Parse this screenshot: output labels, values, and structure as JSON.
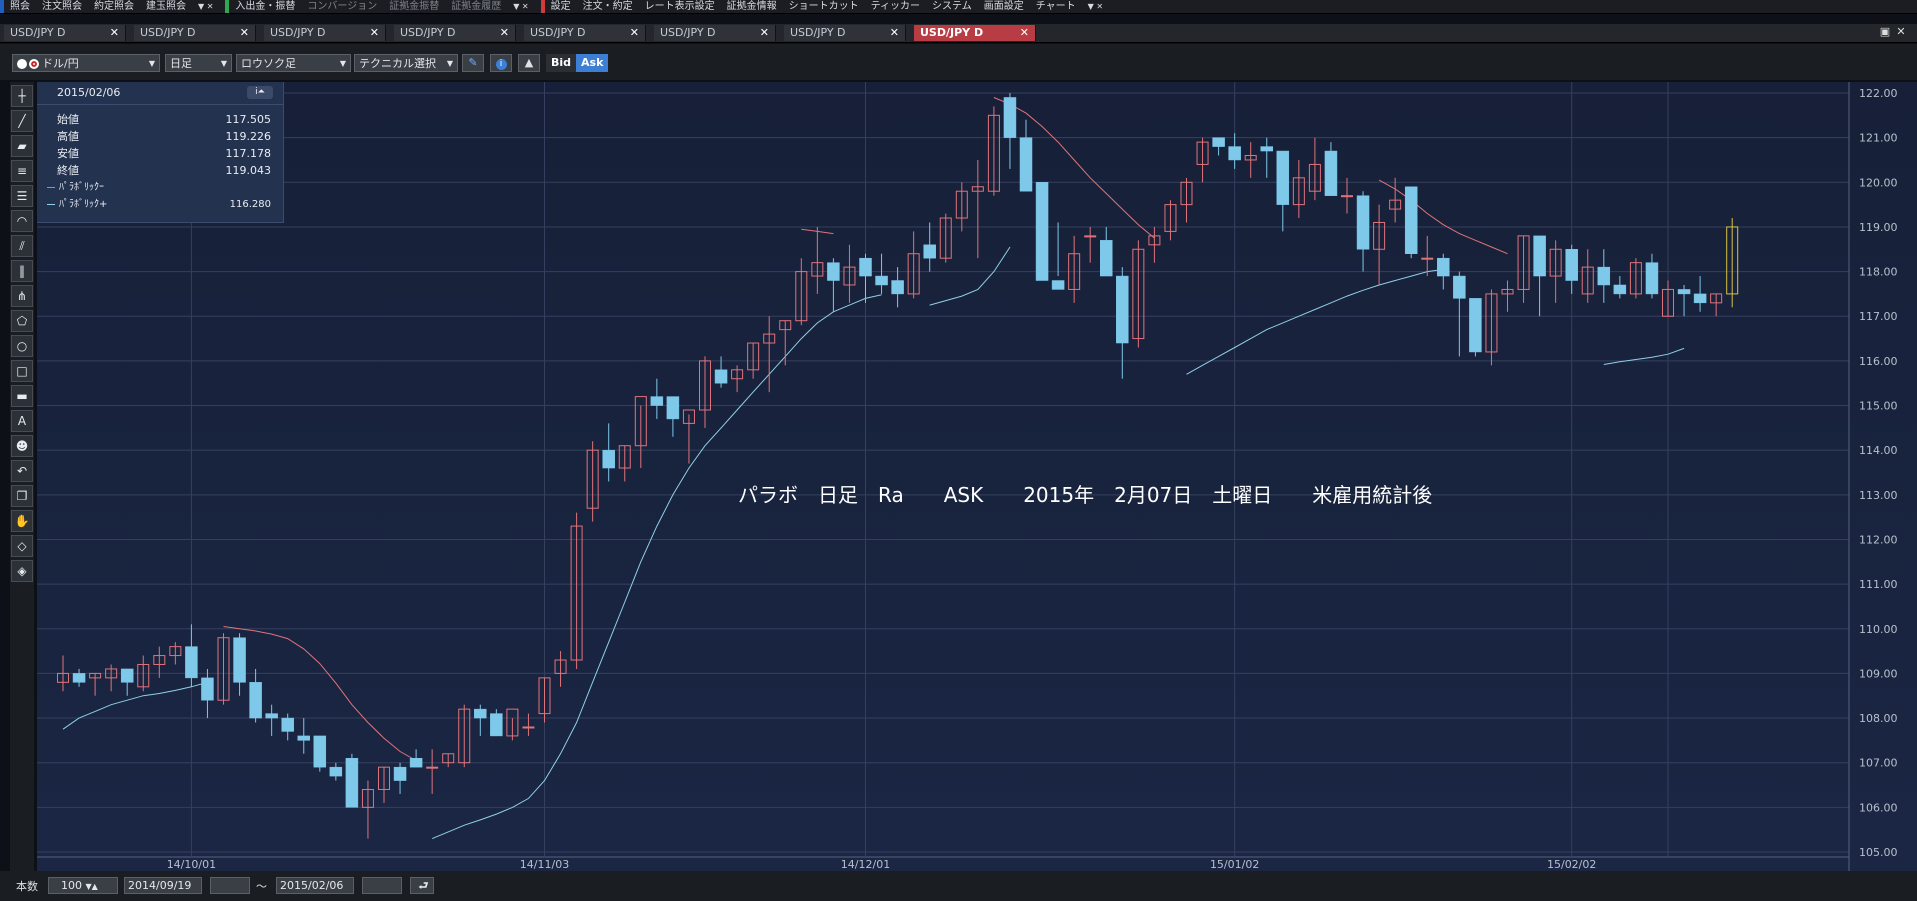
{
  "menubar": {
    "groups": [
      {
        "items": [
          "照会",
          "注文照会",
          "約定照会",
          "建玉照会"
        ]
      },
      {
        "items": [
          "入出金・振替",
          "コンバージョン",
          "証拠金振替",
          "証拠金履歴"
        ]
      },
      {
        "items": [
          "設定",
          "注文・約定",
          "レート表示設定",
          "証拠金情報",
          "ショートカット",
          "ティッカー",
          "システム",
          "画面設定",
          "チャート"
        ]
      }
    ]
  },
  "tabs": [
    "USD/JPY D",
    "USD/JPY D",
    "USD/JPY D",
    "USD/JPY D",
    "USD/JPY D",
    "USD/JPY D",
    "USD/JPY D",
    "USD/JPY D"
  ],
  "active_tab_index": 7,
  "toolbar": {
    "currency": "ドル/円",
    "period": "日足",
    "chart_type": "ロウソク足",
    "technical": "テクニカル選択",
    "bid_label": "Bid",
    "ask_label": "Ask"
  },
  "info_panel": {
    "date": "2015/02/06",
    "rows": [
      {
        "label": "始値",
        "value": "117.505"
      },
      {
        "label": "高値",
        "value": "119.226"
      },
      {
        "label": "安値",
        "value": "117.178"
      },
      {
        "label": "終値",
        "value": "119.043"
      }
    ],
    "indicators": [
      {
        "label": "ﾊﾟﾗﾎﾞﾘｯｸｰ",
        "value": "",
        "color": "#e0737a"
      },
      {
        "label": "ﾊﾟﾗﾎﾞﾘｯｸ+",
        "value": "116.280",
        "color": "#8fd1e8"
      }
    ]
  },
  "bottom": {
    "count_label": "本数",
    "count_value": "100",
    "from_date": "2014/09/19",
    "tilde": "～",
    "to_date": "2015/02/06"
  },
  "chart_data": {
    "type": "candlestick",
    "annotation": "パラボ　日足　Ra　　ASK　　2015年　2月07日　土曜日　　米雇用統計後",
    "ylim": [
      105,
      122
    ],
    "yticks": [
      "105.00",
      "106.00",
      "107.00",
      "108.00",
      "109.00",
      "110.00",
      "111.00",
      "112.00",
      "113.00",
      "114.00",
      "115.00",
      "116.00",
      "117.00",
      "118.00",
      "119.00",
      "120.00",
      "121.00",
      "122.00"
    ],
    "xticks": [
      {
        "label": "14/10/01",
        "index": 8
      },
      {
        "label": "14/11/03",
        "index": 30
      },
      {
        "label": "14/12/01",
        "index": 50
      },
      {
        "label": "15/01/02",
        "index": 73
      },
      {
        "label": "15/02/02",
        "index": 94
      },
      {
        "label": "",
        "index": 100
      }
    ],
    "colors": {
      "up": "#e0737a",
      "down": "#7ec8ea",
      "last": "#d8c24a",
      "sar_minus": "#e0737a",
      "sar_plus": "#8fd1e8"
    },
    "candles": [
      [
        108.8,
        109.4,
        108.6,
        109.0
      ],
      [
        109.0,
        109.1,
        108.7,
        108.8
      ],
      [
        108.9,
        109.0,
        108.5,
        109.0
      ],
      [
        108.9,
        109.2,
        108.6,
        109.1
      ],
      [
        109.1,
        109.1,
        108.5,
        108.8
      ],
      [
        108.7,
        109.4,
        108.6,
        109.2
      ],
      [
        109.2,
        109.6,
        108.9,
        109.4
      ],
      [
        109.4,
        109.7,
        109.2,
        109.6
      ],
      [
        109.6,
        110.1,
        108.7,
        108.9
      ],
      [
        108.9,
        109.1,
        108.0,
        108.4
      ],
      [
        108.4,
        109.9,
        108.3,
        109.8
      ],
      [
        109.8,
        109.9,
        108.5,
        108.8
      ],
      [
        108.8,
        109.1,
        107.9,
        108.0
      ],
      [
        108.1,
        108.3,
        107.6,
        108.0
      ],
      [
        108.0,
        108.1,
        107.5,
        107.7
      ],
      [
        107.6,
        108.0,
        107.2,
        107.5
      ],
      [
        107.6,
        107.6,
        106.8,
        106.9
      ],
      [
        106.9,
        107.0,
        106.6,
        106.7
      ],
      [
        107.1,
        107.2,
        106.2,
        106.0
      ],
      [
        106.0,
        106.6,
        105.3,
        106.4
      ],
      [
        106.4,
        106.9,
        106.1,
        106.9
      ],
      [
        106.9,
        107.0,
        106.3,
        106.6
      ],
      [
        107.1,
        107.3,
        107.0,
        106.9
      ],
      [
        106.9,
        107.3,
        106.3,
        106.9
      ],
      [
        107.0,
        107.2,
        106.9,
        107.2
      ],
      [
        107.0,
        108.3,
        106.9,
        108.2
      ],
      [
        108.2,
        108.3,
        107.6,
        108.0
      ],
      [
        108.1,
        108.2,
        107.6,
        107.6
      ],
      [
        107.6,
        108.0,
        107.5,
        108.2
      ],
      [
        107.8,
        108.1,
        107.6,
        107.8
      ],
      [
        108.1,
        108.9,
        107.9,
        108.9
      ],
      [
        109.0,
        109.5,
        108.7,
        109.3
      ],
      [
        109.3,
        112.6,
        109.1,
        112.3
      ],
      [
        112.7,
        114.2,
        112.4,
        114.0
      ],
      [
        114.0,
        114.6,
        113.3,
        113.6
      ],
      [
        113.6,
        114.1,
        113.3,
        114.1
      ],
      [
        114.1,
        115.0,
        113.6,
        115.2
      ],
      [
        115.2,
        115.6,
        114.7,
        115.0
      ],
      [
        115.2,
        115.2,
        114.3,
        114.7
      ],
      [
        114.6,
        114.8,
        113.7,
        114.9
      ],
      [
        114.9,
        116.1,
        114.5,
        116.0
      ],
      [
        115.8,
        116.1,
        115.4,
        115.5
      ],
      [
        115.6,
        115.9,
        115.3,
        115.8
      ],
      [
        115.8,
        116.4,
        115.6,
        116.4
      ],
      [
        116.4,
        117.0,
        115.3,
        116.6
      ],
      [
        116.7,
        116.9,
        115.9,
        116.9
      ],
      [
        116.9,
        118.3,
        116.8,
        118.0
      ],
      [
        117.9,
        119.0,
        117.5,
        118.2
      ],
      [
        118.2,
        118.3,
        117.1,
        117.8
      ],
      [
        117.7,
        118.6,
        117.3,
        118.1
      ],
      [
        118.3,
        118.4,
        117.3,
        117.9
      ],
      [
        117.9,
        118.4,
        117.5,
        117.7
      ],
      [
        117.8,
        118.1,
        117.2,
        117.5
      ],
      [
        117.5,
        118.9,
        117.4,
        118.4
      ],
      [
        118.6,
        119.1,
        118.0,
        118.3
      ],
      [
        118.3,
        119.3,
        118.2,
        119.2
      ],
      [
        119.2,
        120.0,
        118.9,
        119.8
      ],
      [
        119.8,
        120.5,
        118.3,
        119.9
      ],
      [
        119.8,
        121.7,
        119.7,
        121.5
      ],
      [
        121.9,
        122.0,
        120.3,
        121.0
      ],
      [
        121.0,
        121.4,
        119.8,
        119.8
      ],
      [
        120.0,
        120.0,
        118.2,
        117.8
      ],
      [
        117.8,
        119.1,
        117.9,
        117.6
      ],
      [
        117.6,
        118.8,
        117.3,
        118.4
      ],
      [
        118.8,
        119.0,
        118.2,
        118.8
      ],
      [
        118.7,
        119.0,
        117.9,
        117.9
      ],
      [
        117.9,
        118.1,
        115.6,
        116.4
      ],
      [
        116.5,
        118.7,
        116.3,
        118.5
      ],
      [
        118.6,
        119.0,
        118.2,
        118.8
      ],
      [
        118.9,
        119.6,
        118.7,
        119.5
      ],
      [
        119.5,
        120.1,
        119.1,
        120.0
      ],
      [
        120.4,
        121.0,
        120.0,
        120.9
      ],
      [
        121.0,
        121.0,
        120.6,
        120.8
      ],
      [
        120.8,
        121.1,
        120.3,
        120.5
      ],
      [
        120.5,
        120.9,
        120.1,
        120.6
      ],
      [
        120.8,
        121.0,
        120.1,
        120.7
      ],
      [
        120.7,
        120.7,
        118.9,
        119.5
      ],
      [
        119.5,
        120.5,
        119.2,
        120.1
      ],
      [
        119.8,
        121.0,
        119.6,
        120.4
      ],
      [
        120.7,
        120.9,
        119.9,
        119.7
      ],
      [
        119.7,
        120.1,
        119.3,
        119.7
      ],
      [
        119.7,
        119.8,
        118.0,
        118.5
      ],
      [
        118.5,
        119.5,
        117.7,
        119.1
      ],
      [
        119.4,
        120.1,
        119.1,
        119.6
      ],
      [
        119.9,
        119.9,
        118.3,
        118.4
      ],
      [
        118.3,
        118.8,
        117.9,
        118.3
      ],
      [
        118.3,
        118.4,
        117.6,
        117.9
      ],
      [
        117.9,
        118.0,
        116.1,
        117.4
      ],
      [
        117.4,
        117.4,
        116.1,
        116.2
      ],
      [
        116.2,
        117.6,
        115.9,
        117.5
      ],
      [
        117.5,
        117.8,
        117.1,
        117.6
      ],
      [
        117.6,
        118.8,
        117.3,
        118.8
      ],
      [
        118.8,
        118.8,
        117.0,
        117.9
      ],
      [
        117.9,
        118.7,
        117.3,
        118.5
      ],
      [
        118.5,
        118.6,
        117.5,
        117.8
      ],
      [
        117.5,
        118.5,
        117.3,
        118.1
      ],
      [
        118.1,
        118.5,
        117.3,
        117.7
      ],
      [
        117.7,
        117.9,
        117.4,
        117.5
      ],
      [
        117.5,
        118.3,
        117.4,
        118.2
      ],
      [
        118.2,
        118.4,
        117.4,
        117.5
      ],
      [
        117.0,
        117.8,
        117.0,
        117.6
      ],
      [
        117.6,
        117.7,
        117.0,
        117.5
      ],
      [
        117.5,
        117.9,
        117.1,
        117.3
      ],
      [
        117.3,
        117.5,
        117.0,
        117.5
      ],
      [
        117.5,
        119.2,
        117.2,
        119.0
      ]
    ],
    "sar_plus": [
      [
        [
          0,
          107.75
        ],
        [
          1,
          108.0
        ],
        [
          2,
          108.15
        ],
        [
          3,
          108.3
        ],
        [
          4,
          108.4
        ],
        [
          5,
          108.5
        ],
        [
          6,
          108.55
        ],
        [
          7,
          108.62
        ],
        [
          8,
          108.7
        ],
        [
          9,
          108.8
        ]
      ],
      [
        [
          23,
          105.3
        ],
        [
          24,
          105.45
        ],
        [
          25,
          105.6
        ],
        [
          26,
          105.72
        ],
        [
          27,
          105.85
        ],
        [
          28,
          106.0
        ],
        [
          29,
          106.2
        ],
        [
          30,
          106.6
        ],
        [
          31,
          107.2
        ],
        [
          32,
          107.9
        ],
        [
          33,
          108.8
        ],
        [
          34,
          109.7
        ],
        [
          35,
          110.6
        ],
        [
          36,
          111.5
        ],
        [
          37,
          112.3
        ],
        [
          38,
          113.0
        ],
        [
          39,
          113.6
        ],
        [
          40,
          114.1
        ],
        [
          41,
          114.5
        ],
        [
          42,
          114.9
        ],
        [
          43,
          115.3
        ],
        [
          44,
          115.7
        ],
        [
          45,
          116.1
        ],
        [
          46,
          116.5
        ],
        [
          47,
          116.85
        ],
        [
          48,
          117.1
        ],
        [
          49,
          117.25
        ],
        [
          50,
          117.4
        ],
        [
          51,
          117.48
        ]
      ],
      [
        [
          54,
          117.25
        ],
        [
          55,
          117.35
        ],
        [
          56,
          117.45
        ],
        [
          57,
          117.6
        ],
        [
          58,
          118.0
        ],
        [
          59,
          118.55
        ]
      ],
      [
        [
          70,
          115.7
        ],
        [
          71,
          115.9
        ],
        [
          72,
          116.1
        ],
        [
          73,
          116.3
        ],
        [
          74,
          116.5
        ],
        [
          75,
          116.7
        ],
        [
          76,
          116.85
        ],
        [
          77,
          117.0
        ],
        [
          78,
          117.15
        ],
        [
          79,
          117.3
        ],
        [
          80,
          117.45
        ],
        [
          81,
          117.58
        ],
        [
          82,
          117.7
        ],
        [
          83,
          117.8
        ],
        [
          84,
          117.9
        ],
        [
          85,
          118.0
        ],
        [
          86,
          118.05
        ]
      ],
      [
        [
          96,
          115.92
        ],
        [
          97,
          115.98
        ],
        [
          98,
          116.03
        ],
        [
          99,
          116.08
        ],
        [
          100,
          116.15
        ],
        [
          101,
          116.28
        ]
      ]
    ],
    "sar_minus": [
      [
        [
          10,
          110.05
        ],
        [
          11,
          110.0
        ],
        [
          12,
          109.95
        ],
        [
          13,
          109.88
        ],
        [
          14,
          109.78
        ],
        [
          15,
          109.55
        ],
        [
          16,
          109.22
        ],
        [
          17,
          108.78
        ],
        [
          18,
          108.3
        ],
        [
          19,
          107.9
        ],
        [
          20,
          107.55
        ],
        [
          21,
          107.25
        ],
        [
          22,
          107.05
        ]
      ],
      [
        [
          46,
          118.95
        ],
        [
          47,
          118.9
        ],
        [
          48,
          118.85
        ]
      ],
      [
        [
          58,
          121.9
        ],
        [
          59,
          121.75
        ],
        [
          60,
          121.55
        ],
        [
          61,
          121.25
        ],
        [
          62,
          120.9
        ],
        [
          63,
          120.5
        ],
        [
          64,
          120.1
        ],
        [
          65,
          119.75
        ],
        [
          66,
          119.4
        ],
        [
          67,
          119.05
        ],
        [
          68,
          118.75
        ]
      ],
      [
        [
          82,
          120.05
        ],
        [
          83,
          119.85
        ],
        [
          84,
          119.6
        ],
        [
          85,
          119.3
        ],
        [
          86,
          119.05
        ],
        [
          87,
          118.85
        ],
        [
          88,
          118.7
        ],
        [
          89,
          118.55
        ],
        [
          90,
          118.4
        ]
      ]
    ]
  }
}
